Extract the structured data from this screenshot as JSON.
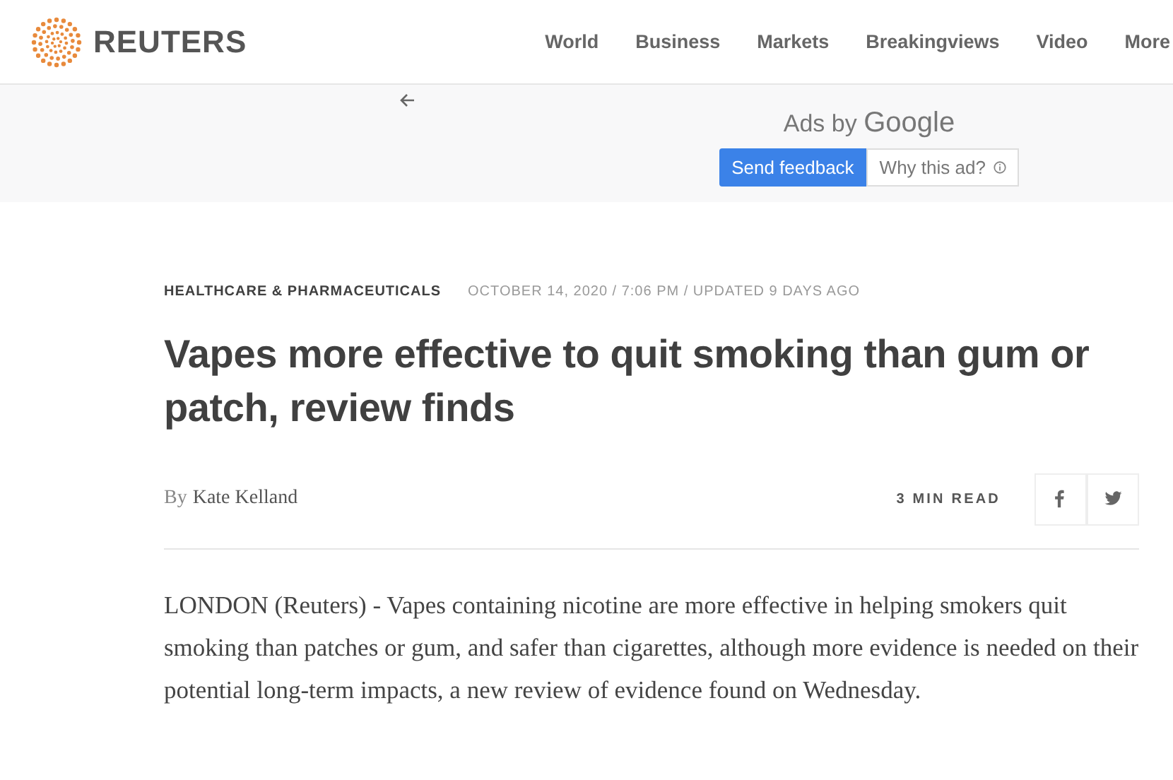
{
  "header": {
    "logo": "REUTERS",
    "nav": [
      {
        "label": "World"
      },
      {
        "label": "Business"
      },
      {
        "label": "Markets"
      },
      {
        "label": "Breakingviews"
      },
      {
        "label": "Video"
      },
      {
        "label": "More"
      }
    ]
  },
  "ad": {
    "title_prefix": "Ads by",
    "title_brand": "Google",
    "buttons": [
      {
        "label": "Send feedback",
        "kind": "primary"
      },
      {
        "label": "Why this ad?",
        "kind": "info"
      }
    ]
  },
  "article": {
    "section": "HEALTHCARE & PHARMACEUTICALS",
    "date": "OCTOBER 14, 2020 / 7:06 PM / UPDATED 9 DAYS AGO",
    "headline": "Vapes more effective to quit smoking than gum or patch, review finds",
    "byline": {
      "prefix": "By",
      "author": "Kate Kelland"
    },
    "read_time": "3 MIN READ",
    "share": [
      {
        "kind": "facebook"
      },
      {
        "kind": "twitter"
      }
    ],
    "body": "LONDON (Reuters) - Vapes containing nicotine are more effective in helping smokers quit smoking than patches or gum, and safer than cigarettes, although more evidence is needed on their potential long-term impacts, a new review of evidence found on Wednesday."
  }
}
